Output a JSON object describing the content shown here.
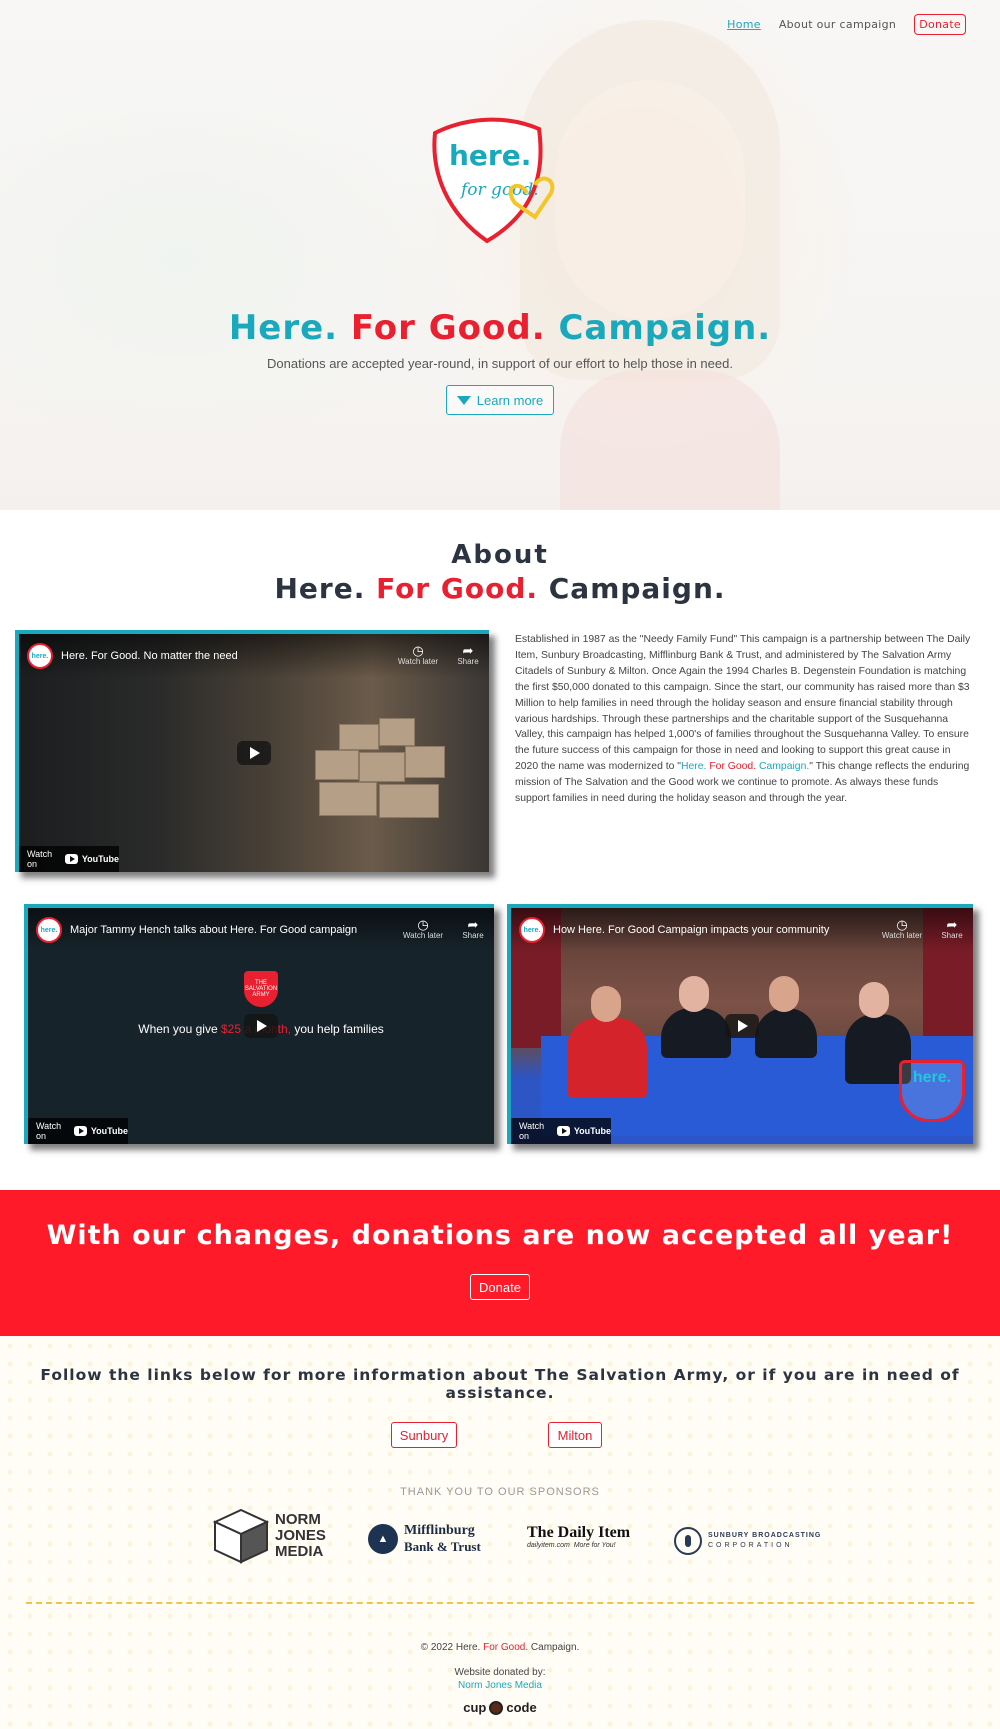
{
  "nav": {
    "home": "Home",
    "about": "About our campaign",
    "donate": "Donate"
  },
  "logo": {
    "line1": "here.",
    "line2": "for good."
  },
  "hero": {
    "title_part1": "Here.",
    "title_part2": "For Good.",
    "title_part3": "Campaign.",
    "subtitle": "Donations are accepted year-round, in support of our effort to help those in need.",
    "learn_more": "Learn more"
  },
  "about": {
    "heading_line1": "About",
    "heading_part1": "Here.",
    "heading_part2": "For Good.",
    "heading_part3": "Campaign.",
    "text_part1": "Established in 1987 as the \"Needy Family Fund\" This campaign is a partnership between The Daily Item, Sunbury Broadcasting, Mifflinburg Bank & Trust, and administered by The Salvation Army Citadels of Sunbury & Milton. Once Again the 1994 Charles B. Degenstein Foundation is matching the first $50,000 donated to this campaign. Since the start, our community has raised more than $3 Million to help families in need through the holiday season and ensure financial stability through various hardships. Through these partnerships and the charitable support of the Susquehanna Valley, this campaign has helped 1,000's of families throughout the Susquehanna Valley. To ensure the future success of this campaign for those in need and looking to support this great cause in 2020 the name was modernized to \"",
    "text_link1": "Here.",
    "text_link2": "For Good.",
    "text_link3": "Campaign.",
    "text_part2": "\" This change reflects the enduring mission of The Salvation and the Good work we continue to promote. As always these funds support families in need during the holiday season and through the year."
  },
  "videos": [
    {
      "title": "Here. For Good. No matter the need",
      "watch_later": "Watch later",
      "share": "Share",
      "watch_on": "Watch on",
      "youtube": "YouTube"
    },
    {
      "title": "Major Tammy Hench talks about Here. For Good campaign",
      "watch_later": "Watch later",
      "share": "Share",
      "watch_on": "Watch on",
      "youtube": "YouTube",
      "overlay_part1": "When you give ",
      "overlay_amount": "$25 a month,",
      "overlay_part2": " you help families",
      "shield": "THE SALVATION ARMY"
    },
    {
      "title": "How Here. For Good Campaign impacts your community",
      "watch_later": "Watch later",
      "share": "Share",
      "watch_on": "Watch on",
      "youtube": "YouTube",
      "logo": "here."
    }
  ],
  "video_avatar": "here.",
  "banner": {
    "heading": "With our changes, donations are now accepted all year!",
    "button": "Donate"
  },
  "links": {
    "heading": "Follow the links below for more information about The Salvation Army, or if you are in need of assistance.",
    "sunbury": "Sunbury",
    "milton": "Milton"
  },
  "sponsors": {
    "heading": "THANK YOU TO OUR SPONSORS",
    "norm_jones": [
      "NORM",
      "JONES",
      "MEDIA"
    ],
    "mifflinburg": [
      "Mifflinburg",
      "Bank & Trust"
    ],
    "daily_item": "The Daily Item",
    "daily_item_tag": "More for You!",
    "daily_item_url": "dailyitem.com",
    "sunbury": [
      "SUNBURY BROADCASTING",
      "CORPORATION"
    ]
  },
  "footer": {
    "copy_part1": "© 2022 Here.",
    "copy_part2": "For Good.",
    "copy_part3": "Campaign.",
    "donated_by": "Website donated by:",
    "donor": "Norm Jones Media",
    "cup": "cup",
    "code": "code"
  },
  "colors": {
    "teal": "#1aa8bd",
    "red": "#e8202f",
    "banner_red": "#ff1a2a",
    "navy": "#2b3440"
  }
}
